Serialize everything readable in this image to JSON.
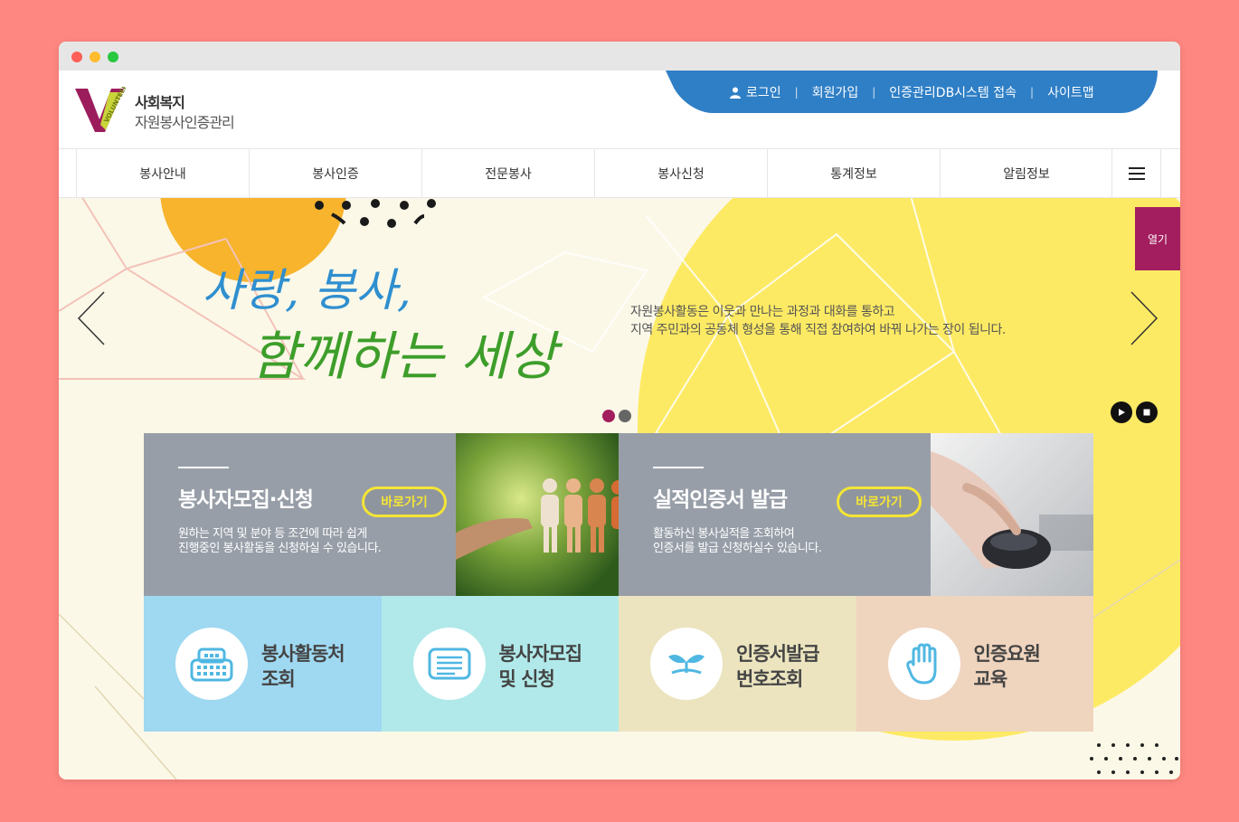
{
  "header": {
    "logo_line1": "사회복지",
    "logo_line2": "자원봉사인증관리",
    "logo_badge": "VOLUNTEER",
    "util_links": [
      {
        "label": "로그인",
        "icon": "user-icon"
      },
      {
        "label": "회원가입"
      },
      {
        "label": "인증관리DB시스템 접속"
      },
      {
        "label": "사이트맵"
      }
    ]
  },
  "nav": {
    "items": [
      "봉사안내",
      "봉사인증",
      "전문봉사",
      "봉사신청",
      "통계정보",
      "알림정보"
    ],
    "menu_icon": "hamburger-icon"
  },
  "hero": {
    "headline1": "사랑, 봉사,",
    "headline2": "함께하는 세상",
    "desc_line1": "자원봉사활동은 이웃과 만나는 과정과 대화를 통하고",
    "desc_line2": "지역 주민과의 공동체 형성을 통해 직접 참여하여 바꿔 나가는 장이 됩니다.",
    "open_label": "열기",
    "colors": {
      "accent": "#a31e5e",
      "blue": "#2f7fc6",
      "yellow": "#fdea64",
      "orange": "#f7b42c"
    }
  },
  "cards": [
    {
      "title": "봉사자모집·신청",
      "button": "바로가기",
      "desc_line1": "원하는 지역 및 분야 등 조건에 따라 쉽게",
      "desc_line2": "진행중인 봉사활동을 신청하실 수 있습니다."
    },
    {
      "title": "실적인증서 발급",
      "button": "바로가기",
      "desc_line1": "활동하신 봉사실적을 조회하여",
      "desc_line2": "인증서를 발급 신청하실수 있습니다."
    }
  ],
  "quick": [
    {
      "line1": "봉사활동처",
      "line2": "조회",
      "icon": "building-icon",
      "bg": "#9fd8f1"
    },
    {
      "line1": "봉사자모집",
      "line2": "및 신청",
      "icon": "document-icon",
      "bg": "#b1e9ea"
    },
    {
      "line1": "인증서발급",
      "line2": "번호조회",
      "icon": "sprout-icon",
      "bg": "#ebe4bf"
    },
    {
      "line1": "인증요원",
      "line2": "교육",
      "icon": "hand-icon",
      "bg": "#efd4be"
    }
  ]
}
